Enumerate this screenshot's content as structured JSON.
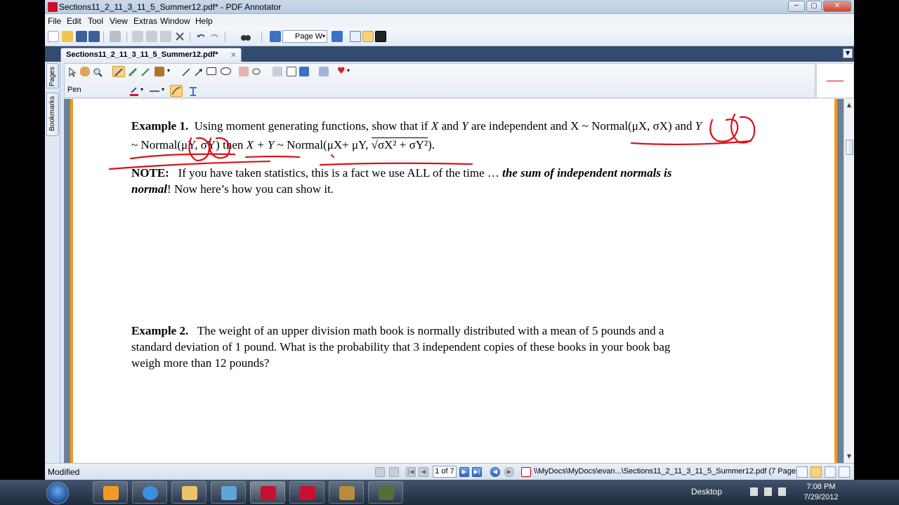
{
  "window": {
    "title": "Sections11_2_11_3_11_5_Summer12.pdf* - PDF Annotator",
    "minimize_glyph": "─",
    "maximize_glyph": "▢",
    "close_glyph": "✕"
  },
  "menu": {
    "items": [
      "File",
      "Edit",
      "Tool",
      "View",
      "Extras",
      "Window",
      "Help"
    ]
  },
  "toolbar": {
    "zoom_value": "Page W",
    "dropdown_glyph": "▾"
  },
  "tabs": {
    "active_label": "Sections11_2_11_3_11_5_Summer12.pdf*",
    "close_glyph": "✕",
    "scroll_glyph": "▼"
  },
  "side_panel": {
    "tabs": [
      "Pages",
      "Bookmarks"
    ]
  },
  "annotation_toolbar": {
    "tool_label": "Pen"
  },
  "document": {
    "example1": {
      "label": "Example 1.",
      "line1_text": "Using moment generating functions, show that if ",
      "var_x": "X",
      "and1": " and ",
      "var_y": "Y",
      "line1_mid": " are independent and ",
      "x_normal": "X ~ Normal(μX, σX)",
      "and2": " and ",
      "line2_start": "~ Normal(μY, σY) then ",
      "sum_expr": "X + Y",
      "line2_mid": " ~ Normal(μX+ μY, ",
      "sqrt_expr": "√σX² + σY²",
      "line2_end": ")."
    },
    "note": {
      "label": "NOTE:",
      "text": "If you have taken statistics, this is a fact we use ALL of the time … ",
      "emph1": "the sum of independent normals is",
      "emph2": "normal",
      "text2": "!  Now here’s how you can show it."
    },
    "example2": {
      "label": "Example 2.",
      "line1": "The weight of an upper division math book is normally distributed with a mean of 5 pounds and a",
      "line2": "standard deviation of 1 pound.  What is the probability that 3 independent copies of these books in your book bag",
      "line3": "weigh more than 12 pounds?"
    },
    "scroll_up_glyph": "▲",
    "scroll_down_glyph": "▼"
  },
  "status_bar": {
    "status": "Modified",
    "page_indicator": "1 of 7",
    "path": "\\\\MyDocs\\MyDocs\\evan...\\Sections11_2_11_3_11_5_Summer12.pdf (7 Pages)",
    "first_glyph": "|◀",
    "prev_glyph": "◀",
    "next_glyph": "▶",
    "last_glyph": "▶|",
    "back_glyph": "◀",
    "forward_glyph": "▶"
  },
  "taskbar": {
    "desktop_label": "Desktop",
    "time": "7:08 PM",
    "date": "7/29/2012"
  },
  "colors": {
    "ink": "#d8141a",
    "page_border": "#f09b1f",
    "tab_strip": "#334b6f"
  }
}
